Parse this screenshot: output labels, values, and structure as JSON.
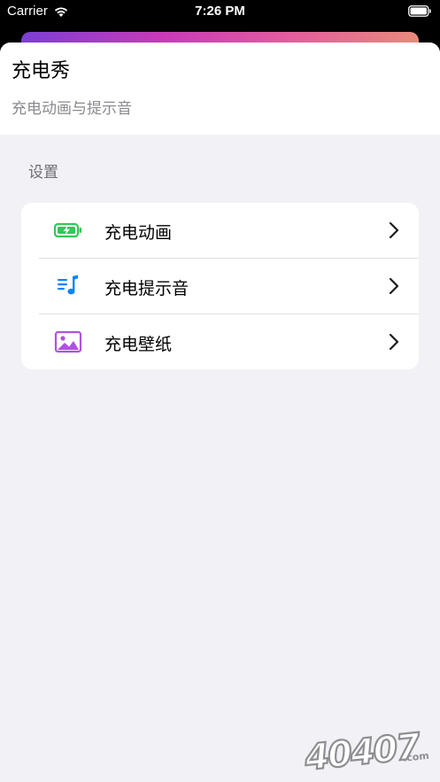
{
  "status_bar": {
    "carrier": "Carrier",
    "time": "7:26 PM"
  },
  "header": {
    "title": "充电秀",
    "subtitle": "充电动画与提示音"
  },
  "settings": {
    "section_title": "设置",
    "items": [
      {
        "label": "充电动画",
        "icon": "battery-charging-icon",
        "icon_color": "#34c759"
      },
      {
        "label": "充电提示音",
        "icon": "music-note-list-icon",
        "icon_color": "#0a84ff"
      },
      {
        "label": "充电壁纸",
        "icon": "photo-icon",
        "icon_color": "#af52de"
      }
    ]
  },
  "watermark": {
    "text": "40407",
    "suffix": ".com"
  },
  "colors": {
    "gradient": [
      "#7b3fd6",
      "#c73ab8",
      "#e25aa0",
      "#e88a7c"
    ],
    "background": "#f2f1f6"
  }
}
